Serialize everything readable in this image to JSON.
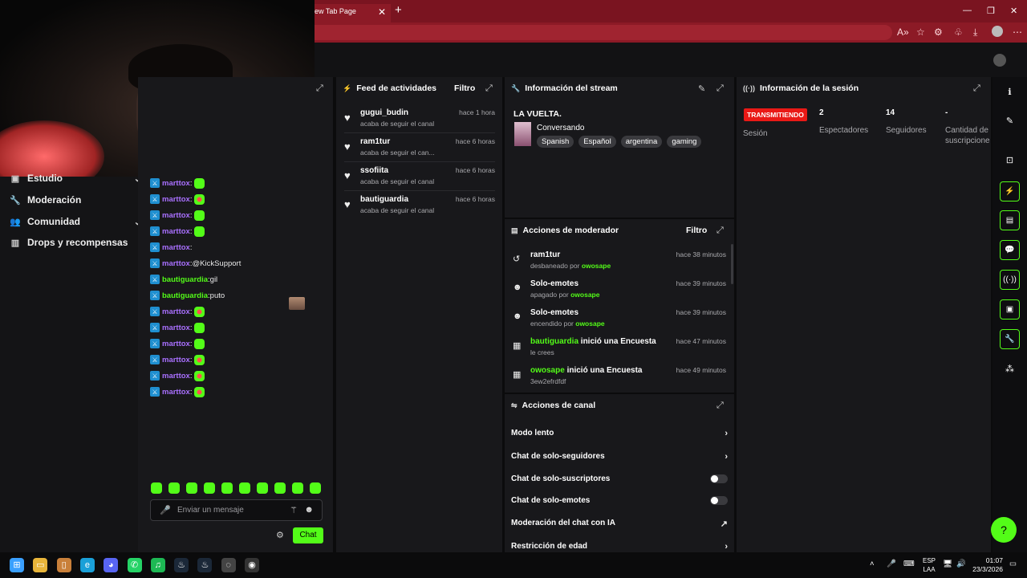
{
  "browser": {
    "tab_title": "ew Tab Page",
    "tab_close": "✕",
    "new_tab": "+",
    "window_controls": [
      "—",
      "❐",
      "✕"
    ],
    "toolbar_icons": [
      "read-aloud-icon",
      "favorites-icon",
      "extensions-icon",
      "collections-icon",
      "download-icon",
      "profile-icon",
      "more-icon"
    ],
    "toolbar_glyphs": [
      "A»",
      "☆",
      "⚙",
      "♧",
      "⤓",
      "⋯"
    ],
    "accent": "#8c1a26"
  },
  "left_nav": {
    "items": [
      {
        "label": "Estudio",
        "icon": "studio-icon",
        "glyph": "▣",
        "chev": "⌄"
      },
      {
        "label": "Moderación",
        "icon": "wrench-icon",
        "glyph": "🔧",
        "chev": ""
      },
      {
        "label": "Comunidad",
        "icon": "users-icon",
        "glyph": "👥",
        "chev": "⌄"
      },
      {
        "label": "Drops y recompensas",
        "icon": "drops-icon",
        "glyph": "▥",
        "chev": ""
      }
    ]
  },
  "chat": {
    "expand_icon": "⤢",
    "messages": [
      {
        "user": "marttox",
        "color": "#a970ff",
        "text": "",
        "emote": "green"
      },
      {
        "user": "marttox",
        "color": "#a970ff",
        "text": "",
        "emote": "red"
      },
      {
        "user": "marttox",
        "color": "#a970ff",
        "text": "",
        "emote": "green"
      },
      {
        "user": "marttox",
        "color": "#a970ff",
        "text": "",
        "emote": "green"
      },
      {
        "user": "marttox",
        "color": "#a970ff",
        "text": "",
        "emote": "face"
      },
      {
        "user": "marttox",
        "color": "#a970ff",
        "text": "@KickSupport",
        "emote": ""
      },
      {
        "user": "bautiguardia",
        "color": "#53fc18",
        "text": "gil",
        "emote": ""
      },
      {
        "user": "bautiguardia",
        "color": "#53fc18",
        "text": "puto",
        "emote": ""
      },
      {
        "user": "marttox",
        "color": "#a970ff",
        "text": "",
        "emote": "red"
      },
      {
        "user": "marttox",
        "color": "#a970ff",
        "text": "",
        "emote": "green"
      },
      {
        "user": "marttox",
        "color": "#a970ff",
        "text": "",
        "emote": "green"
      },
      {
        "user": "marttox",
        "color": "#a970ff",
        "text": "",
        "emote": "red"
      },
      {
        "user": "marttox",
        "color": "#a970ff",
        "text": "",
        "emote": "red"
      },
      {
        "user": "marttox",
        "color": "#a970ff",
        "text": "",
        "emote": "red"
      }
    ],
    "separator": ":",
    "input_placeholder": "Enviar un mensaje",
    "send_label": "Chat",
    "emote_bar_count": 10
  },
  "activity_feed": {
    "title": "Feed de actividades",
    "filter": "Filtro",
    "items": [
      {
        "name": "gugui_budin",
        "sub": "acaba de seguir el canal",
        "time": "hace 1 hora"
      },
      {
        "name": "ram1tur",
        "sub": "acaba de seguir el can...",
        "time": "hace 6 horas"
      },
      {
        "name": "ssofiita",
        "sub": "acaba de seguir el canal",
        "time": "hace 6 horas"
      },
      {
        "name": "bautiguardia",
        "sub": "acaba de seguir el canal",
        "time": "hace 6 horas"
      }
    ]
  },
  "stream_info": {
    "title": "Información del stream",
    "stream_title": "LA VUELTA.",
    "category": "Conversando",
    "tags": [
      "Spanish",
      "Español",
      "argentina",
      "gaming"
    ]
  },
  "mod_actions": {
    "title": "Acciones de moderador",
    "filter": "Filtro",
    "items": [
      {
        "icon": "unban-icon",
        "glyph": "↺",
        "title": "ram1tur",
        "title_green": "",
        "title_rest": "",
        "sub_prefix": "desbaneado por ",
        "sub_user": "owosape",
        "time": "hace 38 minutos"
      },
      {
        "icon": "emote-icon",
        "glyph": "☻",
        "title": "Solo-emotes",
        "title_green": "",
        "title_rest": "",
        "sub_prefix": "apagado por ",
        "sub_user": "owosape",
        "time": "hace 39 minutos"
      },
      {
        "icon": "emote-icon",
        "glyph": "☻",
        "title": "Solo-emotes",
        "title_green": "",
        "title_rest": "",
        "sub_prefix": "encendido por ",
        "sub_user": "owosape",
        "time": "hace 39 minutos"
      },
      {
        "icon": "poll-icon",
        "glyph": "▦",
        "title": "",
        "title_green": "bautiguardia",
        "title_rest": " inició una Encuesta",
        "sub_prefix": "le crees",
        "sub_user": "",
        "time": "hace 47 minutos"
      },
      {
        "icon": "poll-icon",
        "glyph": "▦",
        "title": "",
        "title_green": "owosape",
        "title_rest": " inició una Encuesta",
        "sub_prefix": "3ew2efrdfdf",
        "sub_user": "",
        "time": "hace 49 minutos"
      }
    ]
  },
  "channel_actions": {
    "title": "Acciones de canal",
    "items": [
      {
        "label": "Modo lento",
        "control": "chevron"
      },
      {
        "label": "Chat de solo-seguidores",
        "control": "chevron"
      },
      {
        "label": "Chat de solo-suscriptores",
        "control": "toggle",
        "on": false
      },
      {
        "label": "Chat de solo-emotes",
        "control": "toggle",
        "on": false
      },
      {
        "label": "Moderación del chat con IA",
        "control": "external"
      },
      {
        "label": "Restricción de edad",
        "control": "chevron"
      }
    ],
    "chevron_glyph": "›",
    "external_glyph": "↗"
  },
  "session_info": {
    "title": "Información de la sesión",
    "status_badge": "TRANSMITIENDO",
    "status_label": "Sesión",
    "spectators_value": "2",
    "spectators_label": "Espectadores",
    "followers_value": "14",
    "followers_label": "Seguidores",
    "subs_value": "-",
    "subs_label": "Cantidad de suscripcione"
  },
  "right_rail": {
    "icons": [
      "info-icon",
      "edit-icon",
      "screenshot-icon",
      "bolt-icon",
      "document-icon",
      "chat-icon",
      "broadcast-icon",
      "media-icon",
      "wrench-icon",
      "share-icon"
    ],
    "glyphs": [
      "ℹ",
      "✎",
      "⊡",
      "⚡",
      "▤",
      "💬",
      "((·))",
      "▣",
      "🔧",
      "⁂"
    ],
    "help_glyph": "?"
  },
  "taskbar": {
    "apps": [
      "windows-icon",
      "file-explorer-icon",
      "book-icon",
      "edge-icon",
      "discord-icon",
      "whatsapp-icon",
      "spotify-icon",
      "steam-icon",
      "steam-icon",
      "app-icon",
      "app-icon"
    ],
    "lang_top": "ESP",
    "lang_bottom": "LAA",
    "time": "01:07",
    "date": "23/3/2026",
    "tray_glyphs": [
      "˄",
      "🎤",
      "⌨",
      "🖥",
      "🔊",
      "🔋"
    ]
  },
  "colors": {
    "brand": "#53fc18",
    "live": "#e91916",
    "badge_blue": "#1f8fd0",
    "purple": "#a970ff"
  }
}
